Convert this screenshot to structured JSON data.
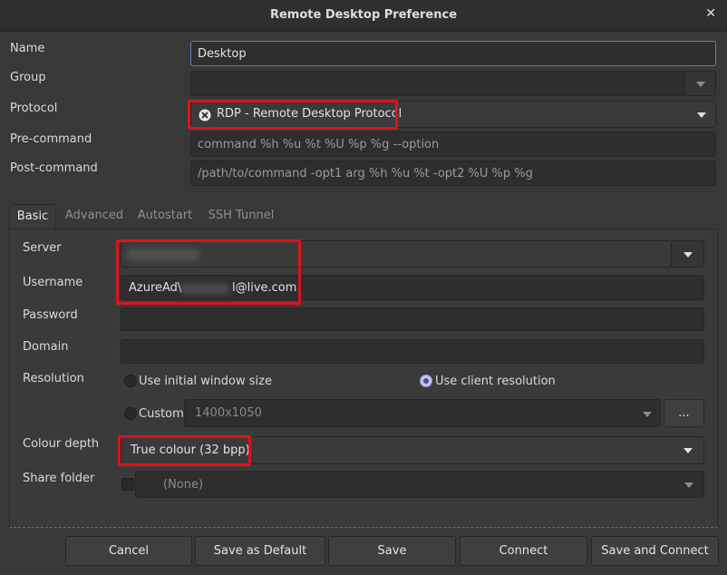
{
  "window": {
    "title": "Remote Desktop Preference",
    "close_glyph": "✕"
  },
  "form": {
    "name_label": "Name",
    "name_value": "Desktop",
    "group_label": "Group",
    "group_value": "",
    "protocol_label": "Protocol",
    "protocol_value": "RDP - Remote Desktop Protocol",
    "precommand_label": "Pre-command",
    "precommand_placeholder": "command %h %u %t %U %p %g --option",
    "postcommand_label": "Post-command",
    "postcommand_placeholder": "/path/to/command -opt1 arg %h %u %t -opt2 %U %p %g"
  },
  "tabs": [
    {
      "label": "Basic",
      "active": true
    },
    {
      "label": "Advanced",
      "active": false
    },
    {
      "label": "Autostart",
      "active": false
    },
    {
      "label": "SSH Tunnel",
      "active": false
    }
  ],
  "basic": {
    "server_label": "Server",
    "server_value": "",
    "username_label": "Username",
    "username_prefix": "AzureAd\\",
    "username_suffix": "l@live.com",
    "password_label": "Password",
    "domain_label": "Domain",
    "resolution_label": "Resolution",
    "res_initial_label": "Use initial window size",
    "res_client_label": "Use client resolution",
    "res_selected": "client",
    "res_custom_label": "Custom",
    "res_custom_value": "1400x1050",
    "res_more_label": "...",
    "colour_label": "Colour depth",
    "colour_value": "True colour (32 bpp)",
    "share_label": "Share folder",
    "share_value": "(None)"
  },
  "buttons": {
    "cancel": "Cancel",
    "save_default": "Save as Default",
    "save": "Save",
    "connect": "Connect",
    "save_connect": "Save and Connect"
  },
  "colors": {
    "highlight": "#d9141b",
    "focus_border": "#5a7fb8",
    "radio_selected": "#4a4aa8"
  }
}
